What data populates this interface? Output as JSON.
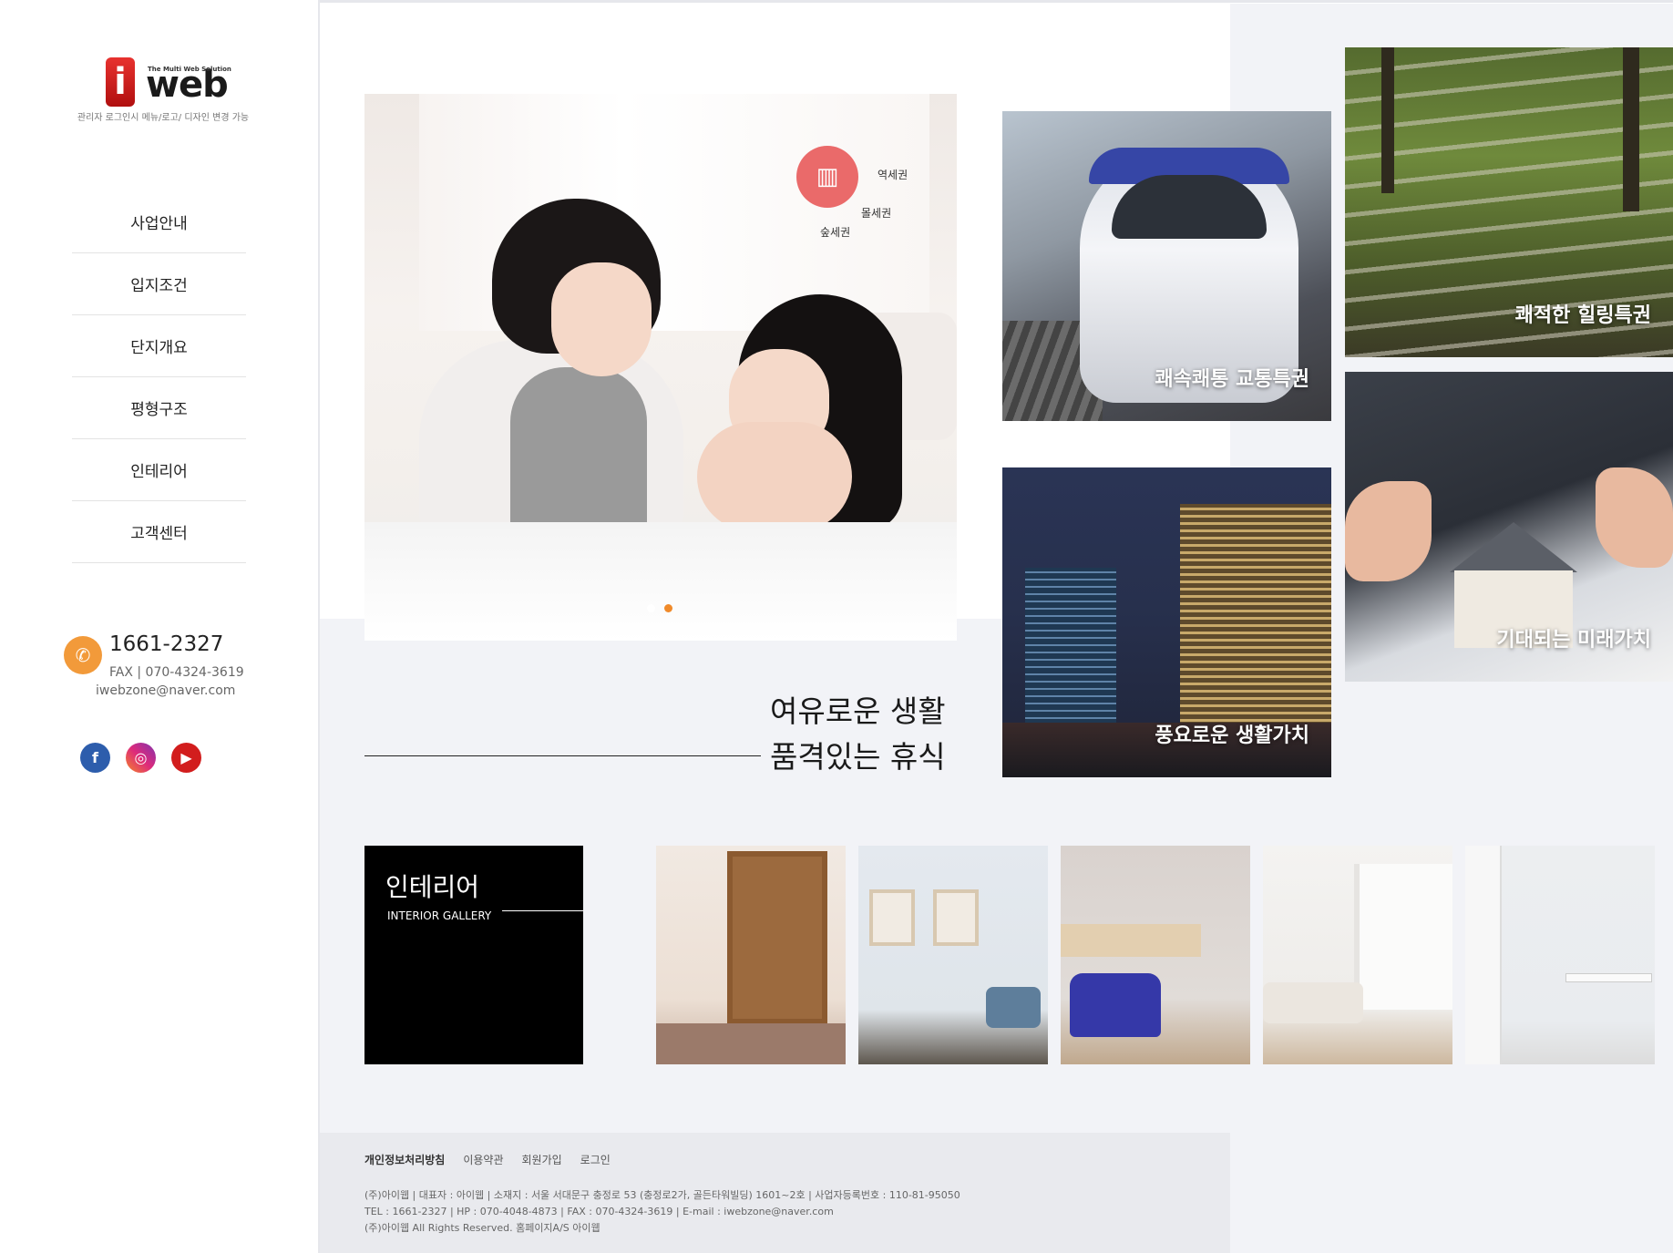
{
  "logo": {
    "mark": "i",
    "word": "web",
    "tagline": "The Multi Web Solution",
    "sub": "관리자 로그인시 메뉴/로고/ 디자인 변경 가능"
  },
  "nav": [
    "사업안내",
    "입지조건",
    "단지개요",
    "평형구조",
    "인테리어",
    "고객센터"
  ],
  "contact": {
    "phone": "1661-2327",
    "fax": "FAX | 070-4324-3619",
    "email": "iwebzone@naver.com"
  },
  "sns": [
    "facebook-icon",
    "instagram-icon",
    "youtube-icon"
  ],
  "hero": {
    "badge_labels": [
      "역세권",
      "몰세권",
      "숲세권"
    ],
    "slide_count": 2,
    "active_slide": 2
  },
  "slogan": {
    "line1": "여유로운 생활",
    "line2": "품격있는 휴식"
  },
  "tiles": {
    "train": "쾌속쾌통 교통특권",
    "forest": "쾌적한 힐링특권",
    "city": "풍요로운 생활가치",
    "house": "기대되는 미래가치"
  },
  "gallery": {
    "title": "인테리어",
    "subtitle": "INTERIOR GALLERY",
    "images": [
      "interior-bookshelf",
      "interior-frames",
      "interior-blue-chair",
      "interior-white-living",
      "interior-kitchen"
    ]
  },
  "footer": {
    "links": [
      "개인정보처리방침",
      "이용약관",
      "회원가입",
      "로그인"
    ],
    "info": [
      "(주)아이웹 | 대표자 : 아이웹 | 소재지 : 서울 서대문구 충정로 53 (충정로2가, 골든타워빌딩) 1601~2호 | 사업자등록번호 : 110-81-95050",
      "TEL : 1661-2327 | HP : 070-4048-4873 | FAX : 070-4324-3619 | E-mail : iwebzone@naver.com",
      "(주)아이웹 All Rights Reserved.    홈페이지A/S 아이웹"
    ]
  },
  "colors": {
    "accent": "#f08a2a",
    "badge": "#ea6a6a",
    "bg": "#f2f3f7"
  }
}
